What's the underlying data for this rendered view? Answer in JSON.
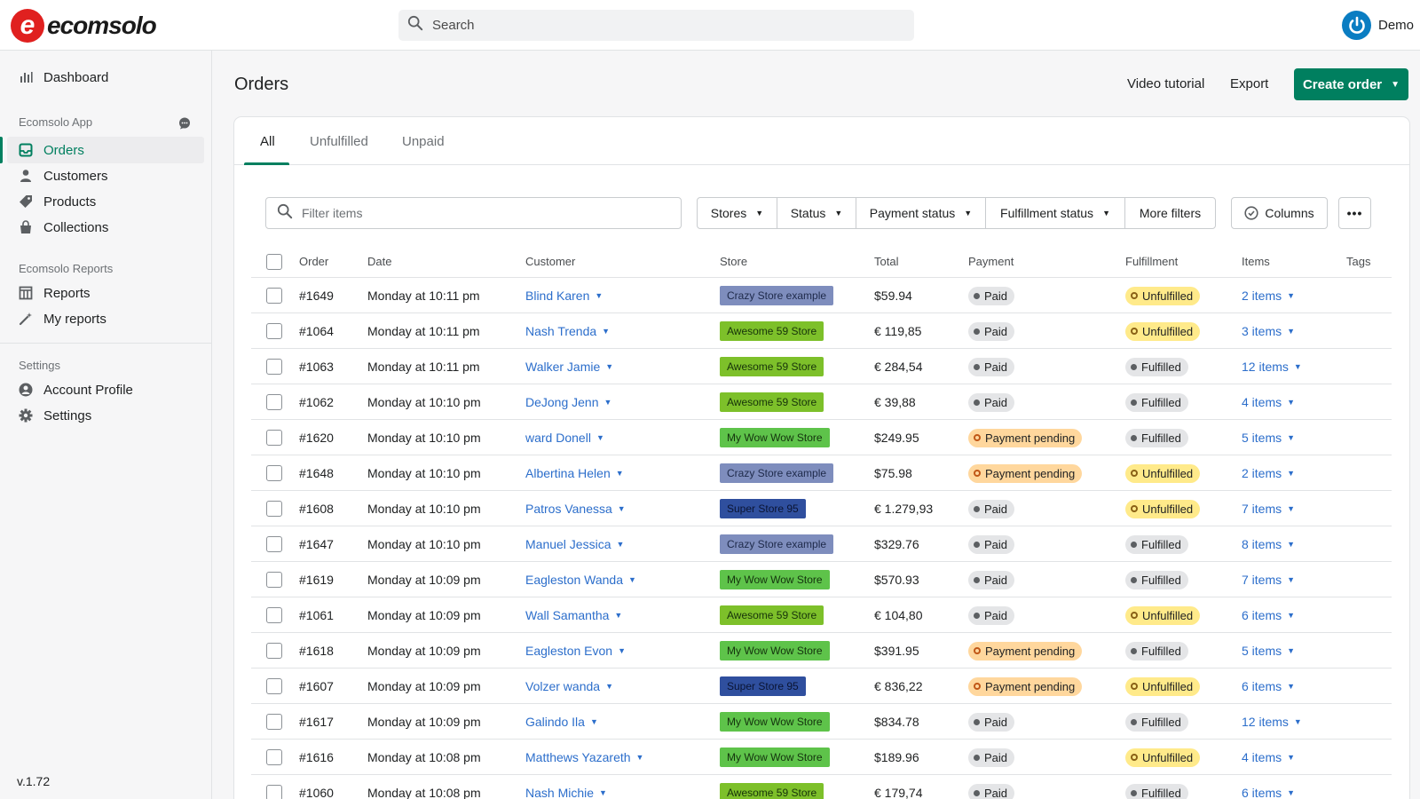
{
  "brand": {
    "logo_letter": "e",
    "logo_text": "ecomsolo",
    "accent": "#007f5f",
    "logo_red": "#e0201f"
  },
  "search": {
    "placeholder": "Search"
  },
  "user": {
    "name": "Demo"
  },
  "sidebar": {
    "dashboard": "Dashboard",
    "section_app": "Ecomsolo App",
    "app_items": [
      {
        "label": "Orders",
        "icon": "inbox-icon",
        "active": true
      },
      {
        "label": "Customers",
        "icon": "person-icon"
      },
      {
        "label": "Products",
        "icon": "tag-icon"
      },
      {
        "label": "Collections",
        "icon": "bag-icon"
      }
    ],
    "section_reports": "Ecomsolo Reports",
    "report_items": [
      {
        "label": "Reports",
        "icon": "grid-icon"
      },
      {
        "label": "My reports",
        "icon": "wand-icon"
      }
    ],
    "section_settings": "Settings",
    "settings_items": [
      {
        "label": "Account Profile",
        "icon": "account-icon"
      },
      {
        "label": "Settings",
        "icon": "gear-icon"
      }
    ],
    "version": "v.1.72"
  },
  "header": {
    "title": "Orders",
    "video_tutorial": "Video tutorial",
    "export": "Export",
    "create_order": "Create order"
  },
  "tabs": [
    "All",
    "Unfulfilled",
    "Unpaid"
  ],
  "filters": {
    "placeholder": "Filter items",
    "stores": "Stores",
    "status": "Status",
    "payment_status": "Payment status",
    "fulfillment_status": "Fulfillment status",
    "more_filters": "More filters",
    "columns": "Columns"
  },
  "table": {
    "columns": [
      "Order",
      "Date",
      "Customer",
      "Store",
      "Total",
      "Payment",
      "Fulfillment",
      "Items",
      "Tags"
    ],
    "store_colors": {
      "Crazy Store example": {
        "bg": "#7e8dbd",
        "fg": "#1e2a4a"
      },
      "Awesome 59 Store": {
        "bg": "#7dc02a",
        "fg": "#17330a"
      },
      "My Wow Wow Store": {
        "bg": "#5ec34a",
        "fg": "#14330e"
      },
      "Super Store 95": {
        "bg": "#2f4f9e",
        "fg": "#0a1433"
      }
    },
    "rows": [
      {
        "order": "#1649",
        "date": "Monday at 10:11 pm",
        "customer": "Blind Karen",
        "store": "Crazy Store example",
        "total": "$59.94",
        "payment": "Paid",
        "fulfillment": "Unfulfilled",
        "items": "2 items"
      },
      {
        "order": "#1064",
        "date": "Monday at 10:11 pm",
        "customer": "Nash Trenda",
        "store": "Awesome 59 Store",
        "total": "€ 119,85",
        "payment": "Paid",
        "fulfillment": "Unfulfilled",
        "items": "3 items"
      },
      {
        "order": "#1063",
        "date": "Monday at 10:11 pm",
        "customer": "Walker Jamie",
        "store": "Awesome 59 Store",
        "total": "€ 284,54",
        "payment": "Paid",
        "fulfillment": "Fulfilled",
        "items": "12 items"
      },
      {
        "order": "#1062",
        "date": "Monday at 10:10 pm",
        "customer": "DeJong Jenn",
        "store": "Awesome 59 Store",
        "total": "€ 39,88",
        "payment": "Paid",
        "fulfillment": "Fulfilled",
        "items": "4 items"
      },
      {
        "order": "#1620",
        "date": "Monday at 10:10 pm",
        "customer": "ward Donell",
        "store": "My Wow Wow Store",
        "total": "$249.95",
        "payment": "Payment pending",
        "fulfillment": "Fulfilled",
        "items": "5 items"
      },
      {
        "order": "#1648",
        "date": "Monday at 10:10 pm",
        "customer": "Albertina Helen",
        "store": "Crazy Store example",
        "total": "$75.98",
        "payment": "Payment pending",
        "fulfillment": "Unfulfilled",
        "items": "2 items"
      },
      {
        "order": "#1608",
        "date": "Monday at 10:10 pm",
        "customer": "Patros Vanessa",
        "store": "Super Store 95",
        "total": "€ 1.279,93",
        "payment": "Paid",
        "fulfillment": "Unfulfilled",
        "items": "7 items"
      },
      {
        "order": "#1647",
        "date": "Monday at 10:10 pm",
        "customer": "Manuel Jessica",
        "store": "Crazy Store example",
        "total": "$329.76",
        "payment": "Paid",
        "fulfillment": "Fulfilled",
        "items": "8 items"
      },
      {
        "order": "#1619",
        "date": "Monday at 10:09 pm",
        "customer": "Eagleston Wanda",
        "store": "My Wow Wow Store",
        "total": "$570.93",
        "payment": "Paid",
        "fulfillment": "Fulfilled",
        "items": "7 items"
      },
      {
        "order": "#1061",
        "date": "Monday at 10:09 pm",
        "customer": "Wall Samantha",
        "store": "Awesome 59 Store",
        "total": "€ 104,80",
        "payment": "Paid",
        "fulfillment": "Unfulfilled",
        "items": "6 items"
      },
      {
        "order": "#1618",
        "date": "Monday at 10:09 pm",
        "customer": "Eagleston Evon",
        "store": "My Wow Wow Store",
        "total": "$391.95",
        "payment": "Payment pending",
        "fulfillment": "Fulfilled",
        "items": "5 items"
      },
      {
        "order": "#1607",
        "date": "Monday at 10:09 pm",
        "customer": "Volzer wanda",
        "store": "Super Store 95",
        "total": "€ 836,22",
        "payment": "Payment pending",
        "fulfillment": "Unfulfilled",
        "items": "6 items"
      },
      {
        "order": "#1617",
        "date": "Monday at 10:09 pm",
        "customer": "Galindo Ila",
        "store": "My Wow Wow Store",
        "total": "$834.78",
        "payment": "Paid",
        "fulfillment": "Fulfilled",
        "items": "12 items"
      },
      {
        "order": "#1616",
        "date": "Monday at 10:08 pm",
        "customer": "Matthews Yazareth",
        "store": "My Wow Wow Store",
        "total": "$189.96",
        "payment": "Paid",
        "fulfillment": "Unfulfilled",
        "items": "4 items"
      },
      {
        "order": "#1060",
        "date": "Monday at 10:08 pm",
        "customer": "Nash Michie",
        "store": "Awesome 59 Store",
        "total": "€ 179,74",
        "payment": "Paid",
        "fulfillment": "Fulfilled",
        "items": "6 items"
      }
    ]
  }
}
